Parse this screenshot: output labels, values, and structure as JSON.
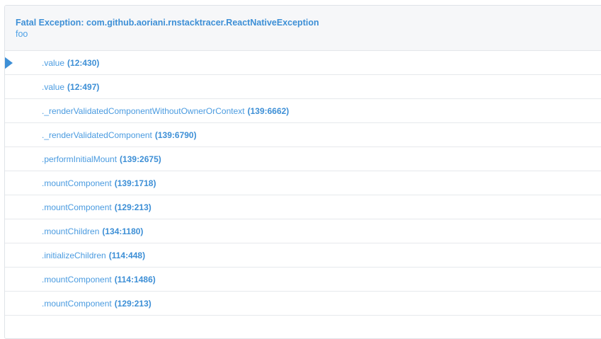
{
  "exception": {
    "title": "Fatal Exception: com.github.aoriani.rnstacktracer.ReactNativeException",
    "message": "foo"
  },
  "frames": [
    {
      "method": ".value",
      "location": "(12:430)",
      "active": true
    },
    {
      "method": ".value",
      "location": "(12:497)",
      "active": false
    },
    {
      "method": "._renderValidatedComponentWithoutOwnerOrContext",
      "location": "(139:6662)",
      "active": false
    },
    {
      "method": "._renderValidatedComponent",
      "location": "(139:6790)",
      "active": false
    },
    {
      "method": ".performInitialMount",
      "location": "(139:2675)",
      "active": false
    },
    {
      "method": ".mountComponent",
      "location": "(139:1718)",
      "active": false
    },
    {
      "method": ".mountComponent",
      "location": "(129:213)",
      "active": false
    },
    {
      "method": ".mountChildren",
      "location": "(134:1180)",
      "active": false
    },
    {
      "method": ".initializeChildren",
      "location": "(114:448)",
      "active": false
    },
    {
      "method": ".mountComponent",
      "location": "(114:1486)",
      "active": false
    },
    {
      "method": ".mountComponent",
      "location": "(129:213)",
      "active": false
    }
  ],
  "colors": {
    "accent": "#3d8fd6",
    "link": "#4a9be0",
    "header_bg": "#f6f7f9",
    "divider": "#e6e9ec"
  }
}
